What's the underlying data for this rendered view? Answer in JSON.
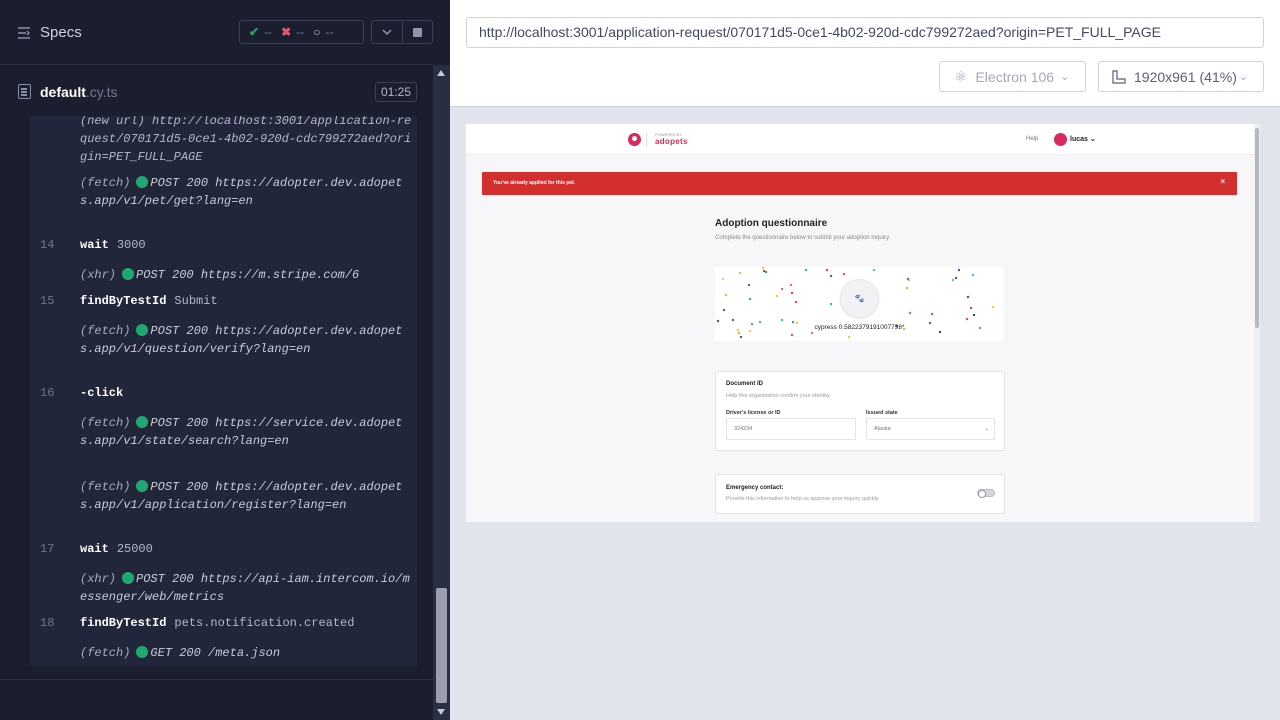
{
  "runner": {
    "specs_label": "Specs",
    "stats": {
      "passed": "--",
      "failed": "--",
      "pending": "--"
    },
    "file": {
      "name": "default",
      "ext": ".cy.ts",
      "duration": "01:25"
    }
  },
  "log": [
    {
      "type": "plain",
      "text": "(new url) http://localhost:3001/application-request/070171d5-0ce1-4b02-920d-cdc799272aed?origin=PET_FULL_PAGE"
    },
    {
      "type": "event",
      "kind": "(fetch)",
      "text": "POST 200 https://adopter.dev.adopets.app/v1/pet/get?lang=en"
    },
    {
      "type": "cmd",
      "num": "14",
      "name": "wait",
      "arg": "3000"
    },
    {
      "type": "event",
      "kind": "(xhr)",
      "text": "POST 200 https://m.stripe.com/6"
    },
    {
      "type": "cmd",
      "num": "15",
      "name": "findByTestId",
      "arg": "Submit"
    },
    {
      "type": "event",
      "kind": "(fetch)",
      "text": "POST 200 https://adopter.dev.adopets.app/v1/question/verify?lang=en"
    },
    {
      "type": "cmd",
      "num": "16",
      "name": "-click",
      "arg": ""
    },
    {
      "type": "event",
      "kind": "(fetch)",
      "text": "POST 200 https://service.dev.adopets.app/v1/state/search?lang=en"
    },
    {
      "type": "event",
      "kind": "(fetch)",
      "text": "POST 200 https://adopter.dev.adopets.app/v1/application/register?lang=en"
    },
    {
      "type": "cmd",
      "num": "17",
      "name": "wait",
      "arg": "25000"
    },
    {
      "type": "event",
      "kind": "(xhr)",
      "text": "POST 200 https://api-iam.intercom.io/messenger/web/metrics"
    },
    {
      "type": "cmd",
      "num": "18",
      "name": "findByTestId",
      "arg": "pets.notification.created"
    },
    {
      "type": "event",
      "kind": "(fetch)",
      "text": "GET 200 /meta.json"
    }
  ],
  "browser": {
    "url": "http://localhost:3001/application-request/070171d5-0ce1-4b02-920d-cdc799272aed?origin=PET_FULL_PAGE",
    "engine": "Electron 106",
    "viewport": "1920x961",
    "zoom": "(41%)"
  },
  "app": {
    "powered_by": "POWERED BY",
    "brand": "adopets",
    "help": "Help",
    "user": "lucas",
    "alert": "You've already applied for this pet.",
    "alert_close": "×",
    "title": "Adoption questionnaire",
    "subtitle": "Complete the questionnaire below to submit your adoption inquiry.",
    "pet_name": "cypress 0.5822379191007798*",
    "doc_title": "Document ID",
    "doc_sub": "Help this organization confirm your identity.",
    "license_label": "Driver's license or ID",
    "license_value": "324234",
    "state_label": "Issued state",
    "state_value": "Alaska",
    "emergency_title": "Emergency contact:",
    "emergency_sub": "Provide this information to help us approve your inquiry quickly."
  },
  "colors": {
    "accent": "#d9295f",
    "success": "#1fa971",
    "alert": "#d32f2f"
  }
}
